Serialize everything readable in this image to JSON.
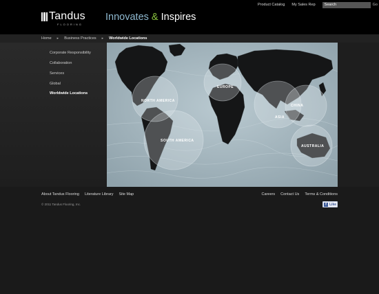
{
  "header": {
    "logo_name": "Tandus",
    "logo_sub": "FLOORING",
    "tagline_part1": "Innovates",
    "tagline_amp": "&",
    "tagline_part2": "Inspires",
    "utility_links": [
      "Product Catalog",
      "My Sales Rep"
    ],
    "search_value": "Search",
    "go_label": "Go"
  },
  "breadcrumb": {
    "items": [
      "Home",
      "Business Practices",
      "Worldwide Locations"
    ]
  },
  "sidebar": {
    "items": [
      {
        "label": "Corporate Responsibility"
      },
      {
        "label": "Collaboration"
      },
      {
        "label": "Services"
      },
      {
        "label": "Global"
      },
      {
        "label": "Worldwide Locations",
        "active": true
      }
    ]
  },
  "map": {
    "regions": [
      "NORTH AMERICA",
      "EUROPE",
      "CHINA",
      "ASIA",
      "SOUTH AMERICA",
      "AUSTRALIA"
    ]
  },
  "footer": {
    "left_links": [
      "About Tandus Flooring",
      "Literature Library",
      "Site Map"
    ],
    "right_links": [
      "Careers",
      "Contact Us",
      "Terms & Conditions"
    ],
    "copyright": "© 2011 Tandus Flooring, Inc.",
    "like_label": "Like"
  },
  "colors": {
    "tagline_blue": "#8fb9d0",
    "tagline_green": "#8ac43f",
    "facebook_blue": "#3b5998"
  }
}
